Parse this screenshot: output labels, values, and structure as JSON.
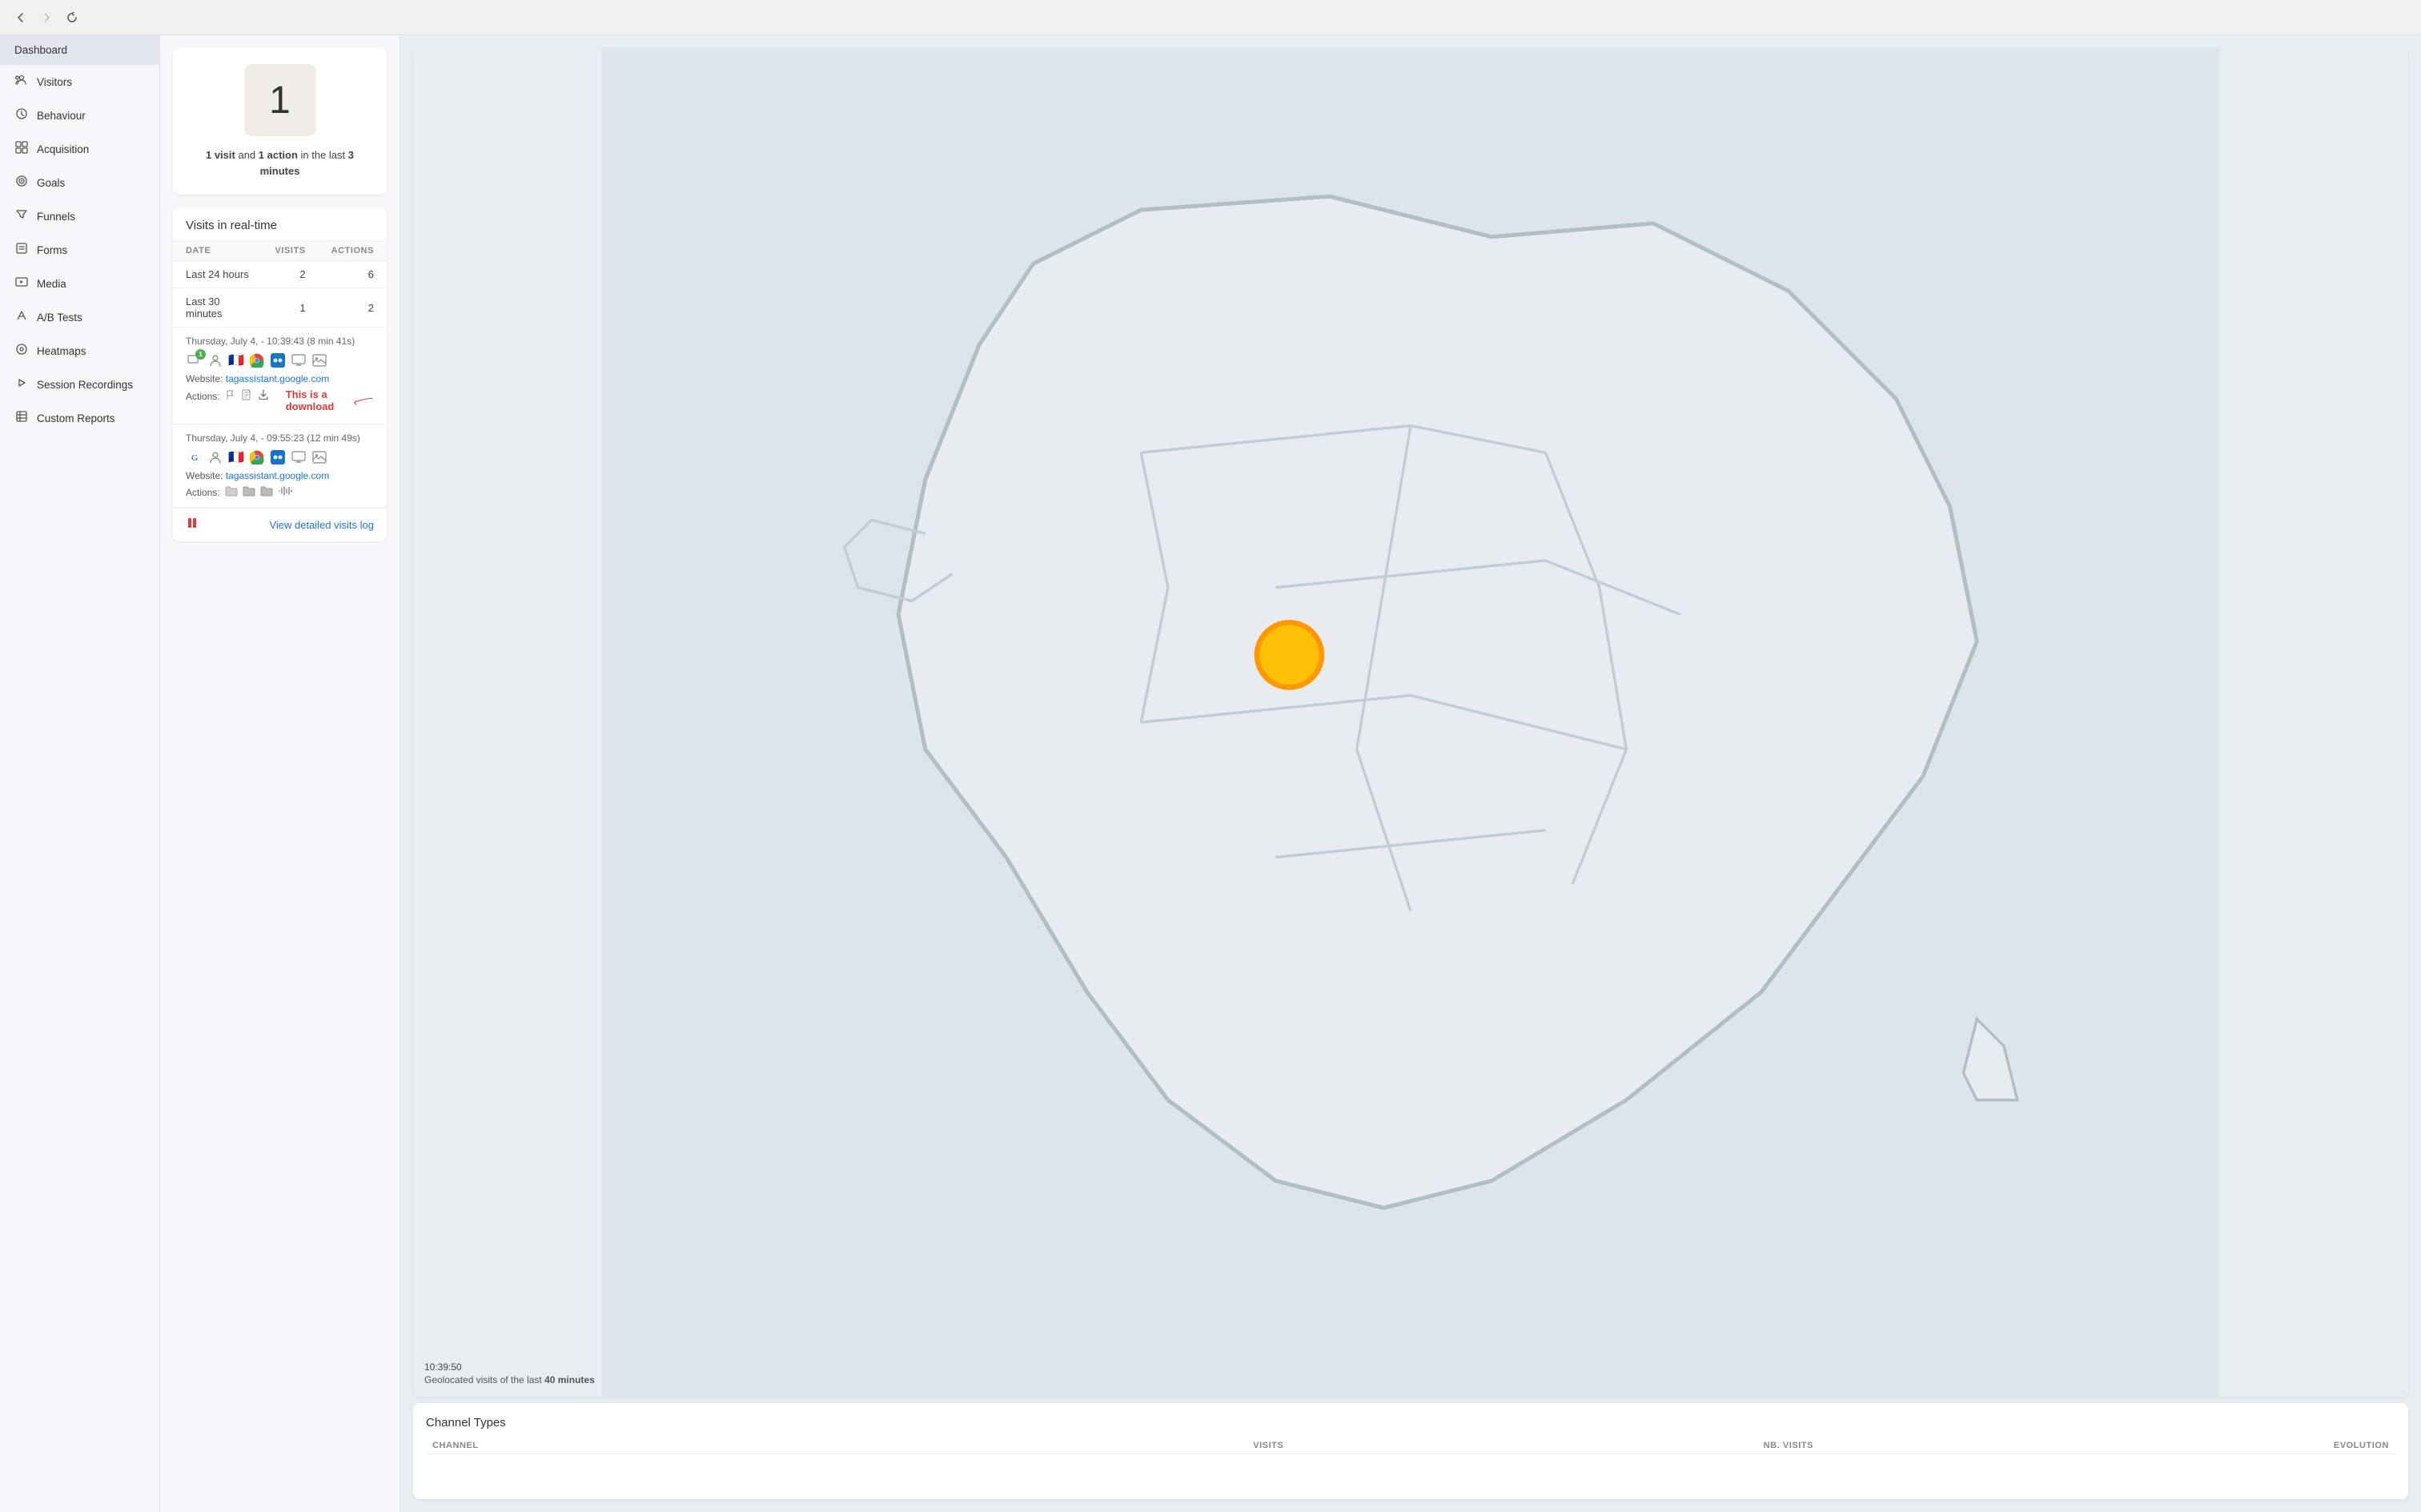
{
  "browser": {
    "back_label": "←",
    "forward_label": "→",
    "refresh_label": "↺"
  },
  "sidebar": {
    "dashboard_label": "Dashboard",
    "items": [
      {
        "id": "visitors",
        "label": "Visitors",
        "icon": "∞"
      },
      {
        "id": "behaviour",
        "label": "Behaviour",
        "icon": "🔔"
      },
      {
        "id": "acquisition",
        "label": "Acquisition",
        "icon": "⊞"
      },
      {
        "id": "goals",
        "label": "Goals",
        "icon": "◎"
      },
      {
        "id": "funnels",
        "label": "Funnels",
        "icon": "⋎"
      },
      {
        "id": "forms",
        "label": "Forms",
        "icon": "⊟"
      },
      {
        "id": "media",
        "label": "Media",
        "icon": "▦"
      },
      {
        "id": "abtests",
        "label": "A/B Tests",
        "icon": "⚗"
      },
      {
        "id": "heatmaps",
        "label": "Heatmaps",
        "icon": "○"
      },
      {
        "id": "session-recordings",
        "label": "Session Recordings",
        "icon": "▷"
      },
      {
        "id": "custom-reports",
        "label": "Custom Reports",
        "icon": "⊠"
      }
    ]
  },
  "stat_card": {
    "number": "1",
    "description_part1": "1 visit",
    "description_and": " and ",
    "description_part2": "1 action",
    "description_rest": " in the last ",
    "description_minutes": "3 minutes"
  },
  "realtime": {
    "title": "Visits in real-time",
    "columns": {
      "date": "DATE",
      "visits": "VISITS",
      "actions": "ACTIONS"
    },
    "rows": [
      {
        "label": "Last 24 hours",
        "visits": "2",
        "actions": "6"
      },
      {
        "label": "Last 30 minutes",
        "visits": "1",
        "actions": "2"
      }
    ]
  },
  "visits": [
    {
      "timestamp": "Thursday, July 4, - 10:39:43 (8 min 41s)",
      "website_label": "Website:",
      "website_url": "tagassistant.google.com",
      "actions_label": "Actions:",
      "has_annotation": true,
      "annotation_text": "This is a download"
    },
    {
      "timestamp": "Thursday, July 4, - 09:55:23 (12 min 49s)",
      "website_label": "Website:",
      "website_url": "tagassistant.google.com",
      "actions_label": "Actions:",
      "has_annotation": false
    }
  ],
  "bottom_bar": {
    "view_log_label": "View detailed visits log"
  },
  "map": {
    "timestamp": "10:39:50",
    "description": "Geolocated visits of the last ",
    "minutes": "40 minutes"
  },
  "channel_types": {
    "title": "Channel Types",
    "columns": {
      "channel": "CHANNEL",
      "visits": "VISITS",
      "nb_visits": "NB. VISITS",
      "evolution": "EVOLUTION"
    }
  }
}
